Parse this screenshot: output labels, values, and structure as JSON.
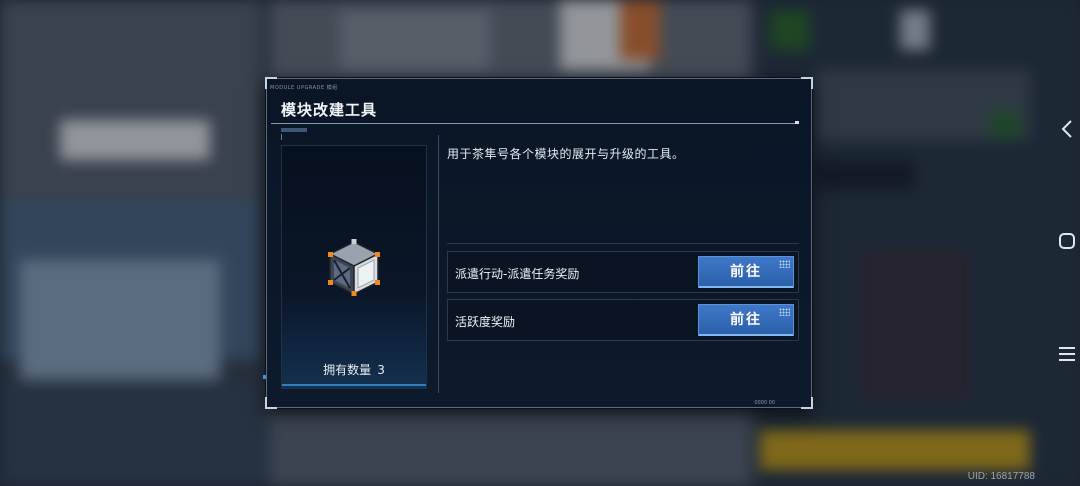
{
  "dialog": {
    "micro_tag": "MODULE UPGRADE\n模组",
    "title": "模块改建工具",
    "description": "用于茶隼号各个模块的展开与升级的工具。",
    "owned_label": "拥有数量",
    "owned_count": "3",
    "sources": [
      {
        "label": "派遣行动-派遣任务奖励",
        "button": "前往"
      },
      {
        "label": "活跃度奖励",
        "button": "前往"
      }
    ],
    "footer_tag": "0000 00"
  },
  "system": {
    "uid": "UID: 16817788",
    "nav_back_icon": "chevron-left-icon",
    "nav_home_icon": "rounded-square-icon",
    "nav_menu_icon": "three-lines-icon"
  },
  "colors": {
    "accent_blue": "#2f6fc0",
    "dialog_bg": "#0a1626",
    "text": "#e6ebf0"
  }
}
